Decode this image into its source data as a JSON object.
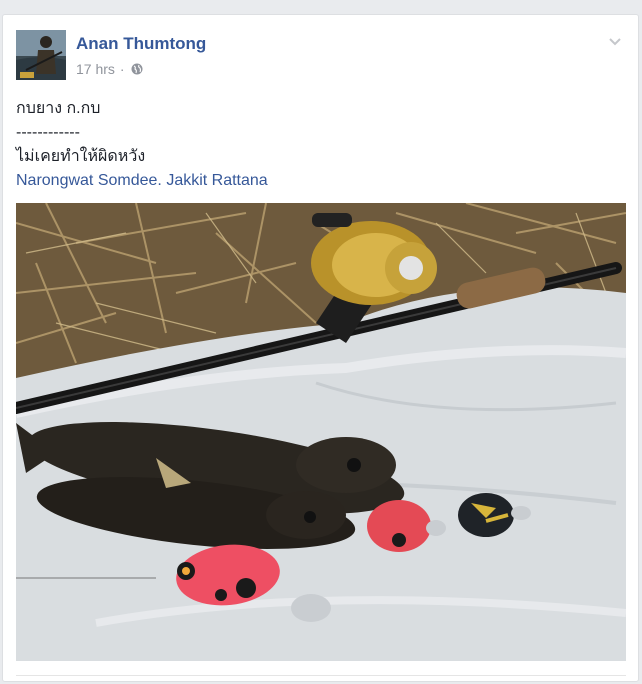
{
  "post": {
    "author": "Anan Thumtong",
    "time": "17 hrs",
    "separator": "·",
    "privacy_icon": "globe-icon",
    "menu_icon": "chevron-down-icon",
    "text_lines": [
      "กบยาง ก.กบ",
      "------------",
      "ไม่เคยทำให้ผิดหวัง"
    ],
    "tags": [
      {
        "name": "Narongwat Somdee."
      },
      {
        "name": "Jakkit Rattana"
      }
    ],
    "photo": "fishing-photo"
  },
  "colors": {
    "page_bg": "#e9ebee",
    "link": "#365899",
    "meta": "#90949c",
    "text": "#1d2129"
  }
}
